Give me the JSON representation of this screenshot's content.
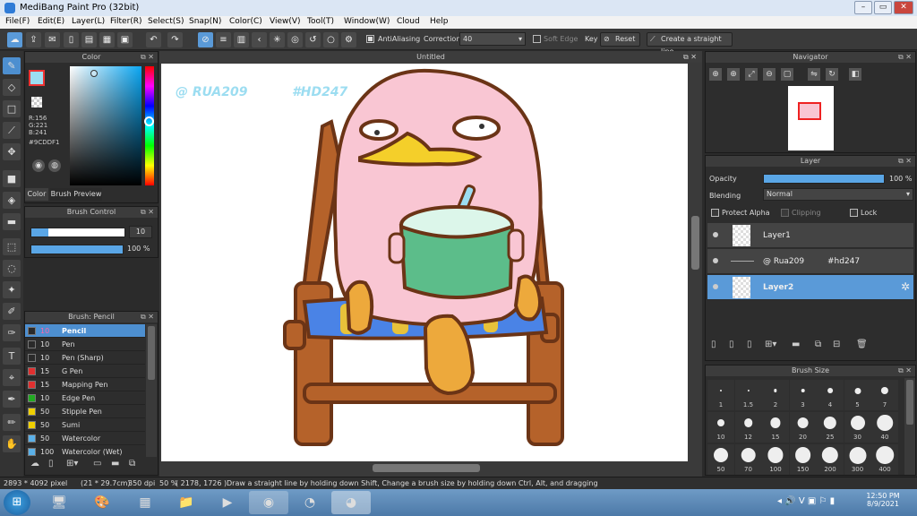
{
  "window": {
    "title": "MediBang Paint Pro (32bit)"
  },
  "menu": [
    "File(F)",
    "Edit(E)",
    "Layer(L)",
    "Filter(R)",
    "Select(S)",
    "Snap(N)",
    "Color(C)",
    "View(V)",
    "Tool(T)",
    "Window(W)",
    "Cloud",
    "Help"
  ],
  "toolbar": {
    "antialiasing": "AntiAliasing",
    "correction_label": "Correction",
    "correction_value": "40",
    "soft_edge": "Soft Edge",
    "key": "Key",
    "reset": "Reset",
    "straight_line": "Create a straight line"
  },
  "color_panel": {
    "title": "Color",
    "r": "R:156",
    "g": "G:221",
    "b": "B:241",
    "hex": "#9CDDF1",
    "tab_color": "Color",
    "tab_brush_preview": "Brush Preview"
  },
  "brush_control": {
    "title": "Brush Control",
    "size": "10",
    "opacity": "100 %"
  },
  "brush_panel": {
    "title": "Brush: Pencil",
    "items": [
      {
        "size": "10",
        "name": "Pencil",
        "color": "#2a2a2a"
      },
      {
        "size": "10",
        "name": "Pen",
        "color": "#2a2a2a"
      },
      {
        "size": "10",
        "name": "Pen (Sharp)",
        "color": "#2a2a2a"
      },
      {
        "size": "15",
        "name": "G Pen",
        "color": "#e03030"
      },
      {
        "size": "15",
        "name": "Mapping Pen",
        "color": "#e03030"
      },
      {
        "size": "10",
        "name": "Edge Pen",
        "color": "#22aa22"
      },
      {
        "size": "50",
        "name": "Stipple Pen",
        "color": "#f0d000"
      },
      {
        "size": "50",
        "name": "Sumi",
        "color": "#f0d000"
      },
      {
        "size": "50",
        "name": "Watercolor",
        "color": "#5ab0e8"
      },
      {
        "size": "100",
        "name": "Watercolor (Wet)",
        "color": "#5ab0e8"
      }
    ]
  },
  "canvas": {
    "title": "Untitled",
    "text1": "@ RUA209",
    "text2": "#HD247"
  },
  "navigator": {
    "title": "Navigator"
  },
  "layer_panel": {
    "title": "Layer",
    "opacity_label": "Opacity",
    "opacity_value": "100 %",
    "blending_label": "Blending",
    "blending_value": "Normal",
    "protect_alpha": "Protect Alpha",
    "clipping": "Clipping",
    "lock": "Lock",
    "layers": [
      {
        "name": "Layer1",
        "extra": ""
      },
      {
        "name": "@ Rua209",
        "extra": "#hd247"
      },
      {
        "name": "Layer2",
        "extra": ""
      }
    ]
  },
  "brush_size": {
    "title": "Brush Size",
    "row1": [
      "1",
      "1.5",
      "2",
      "3",
      "4",
      "5",
      "7"
    ],
    "row2": [
      "10",
      "12",
      "15",
      "20",
      "25",
      "30",
      "40"
    ],
    "row3": [
      "50",
      "70",
      "100",
      "150",
      "200",
      "300",
      "400"
    ]
  },
  "status": {
    "size": "2893 * 4092 pixel",
    "cm": "(21 * 29.7cm)",
    "dpi": "350 dpi",
    "zoom": "50 %",
    "coords": "( 2178, 1726 )",
    "hint": "Draw a straight line by holding down Shift, Change a brush size by holding down Ctrl, Alt, and dragging"
  },
  "taskbar": {
    "time": "12:50 PM",
    "date": "8/9/2021"
  },
  "colors": {
    "accent": "#5a9ad8",
    "current_color": "#9CDDF1",
    "character_pink": "#f9c6d3",
    "bowl_green": "#5cbd8a",
    "chair_brown": "#b5622a"
  }
}
